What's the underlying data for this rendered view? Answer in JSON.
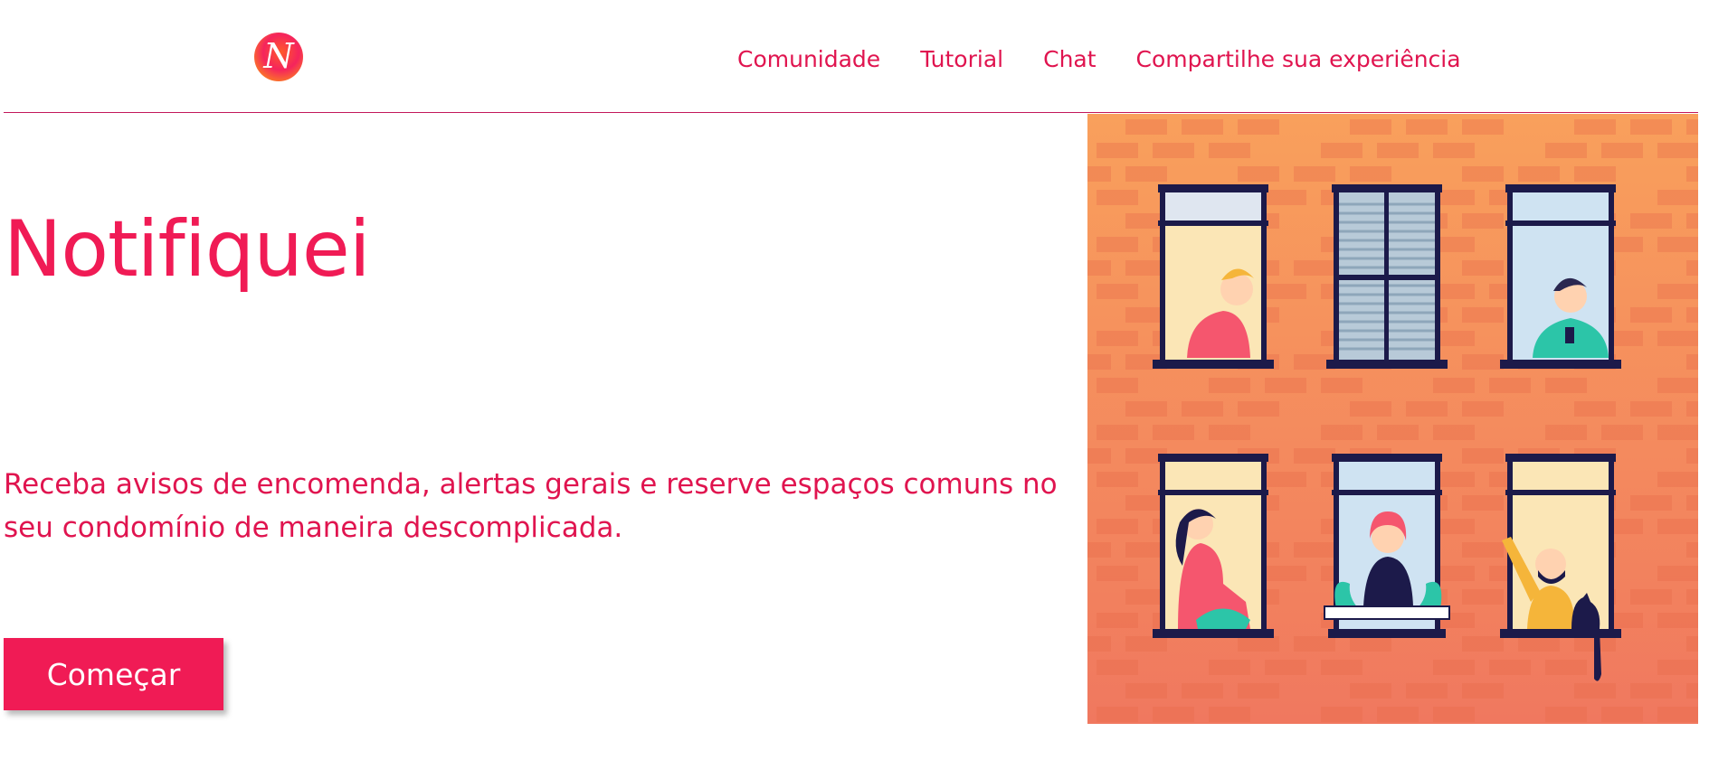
{
  "header": {
    "logo": {
      "letter": "N",
      "icon": "brand-logo-icon"
    },
    "nav": [
      {
        "label": "Comunidade"
      },
      {
        "label": "Tutorial"
      },
      {
        "label": "Chat"
      },
      {
        "label": "Compartilhe sua experiência"
      }
    ]
  },
  "hero": {
    "title": "Notifiquei",
    "subtitle": "Receba avisos de encomenda, alertas gerais e reserve espaços comuns no seu condomínio de maneira descomplicada.",
    "cta_label": "Começar"
  },
  "illustration": {
    "icon": "apartment-building-windows-illustration",
    "colors": {
      "brick_top": "#f9a05c",
      "brick_bottom": "#f0785f",
      "frame": "#1c1a4a",
      "accent": "#f01b55"
    }
  }
}
